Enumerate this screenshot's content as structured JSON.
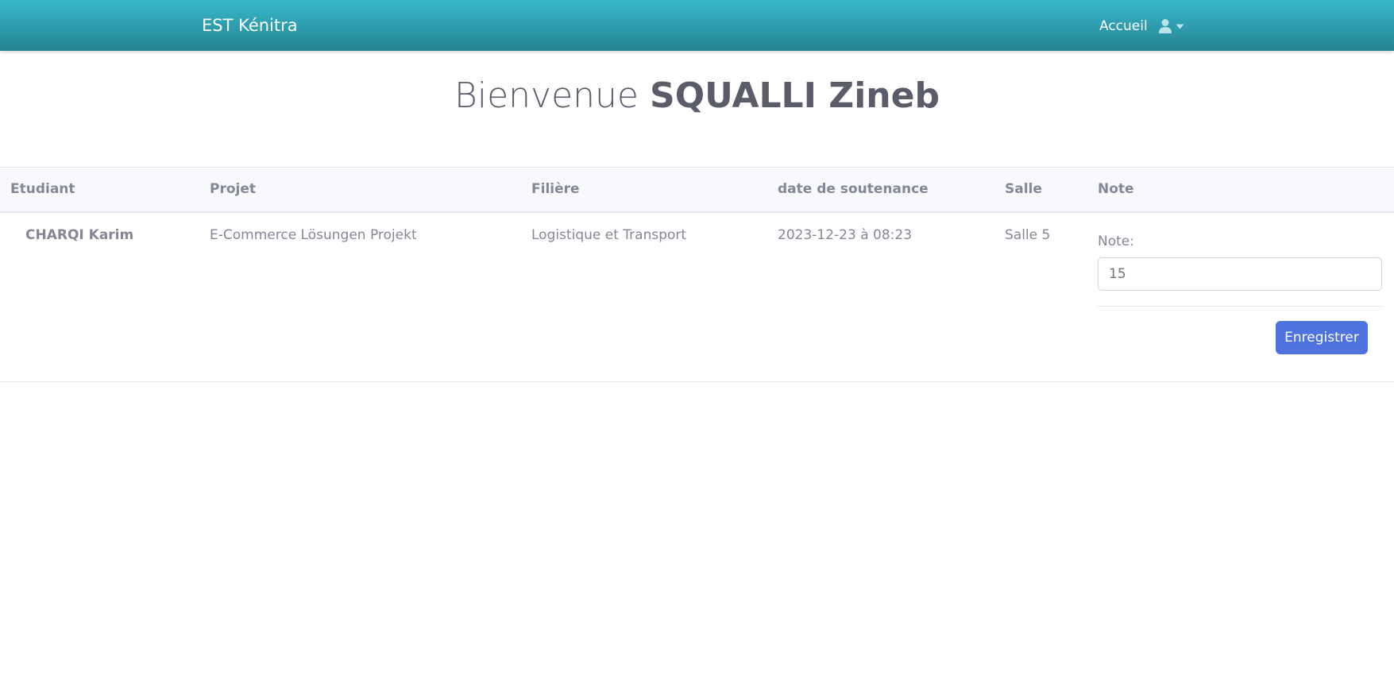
{
  "navbar": {
    "brand": "EST Kénitra",
    "home_label": "Accueil",
    "user_icon": "user-icon",
    "caret_icon": "caret-down-icon",
    "background_color": "#36b9cc"
  },
  "welcome": {
    "prefix": "Bienvenue",
    "name": "SQUALLI Zineb"
  },
  "table": {
    "headers": [
      "Etudiant",
      "Projet",
      "Filière",
      "date de soutenance",
      "Salle",
      "Note"
    ],
    "rows": [
      {
        "student": "CHARQI Karim",
        "project": "E-Commerce Lösungen Projekt",
        "field": "Logistique et Transport",
        "defense_date": "2023-12-23 à 08:23",
        "room": "Salle 5",
        "note_label": "Note:",
        "note_value": "15",
        "save_label": "Enregistrer"
      }
    ]
  },
  "colors": {
    "primary_button": "#4e73df",
    "heading": "#5a5c69",
    "text": "#858796"
  }
}
